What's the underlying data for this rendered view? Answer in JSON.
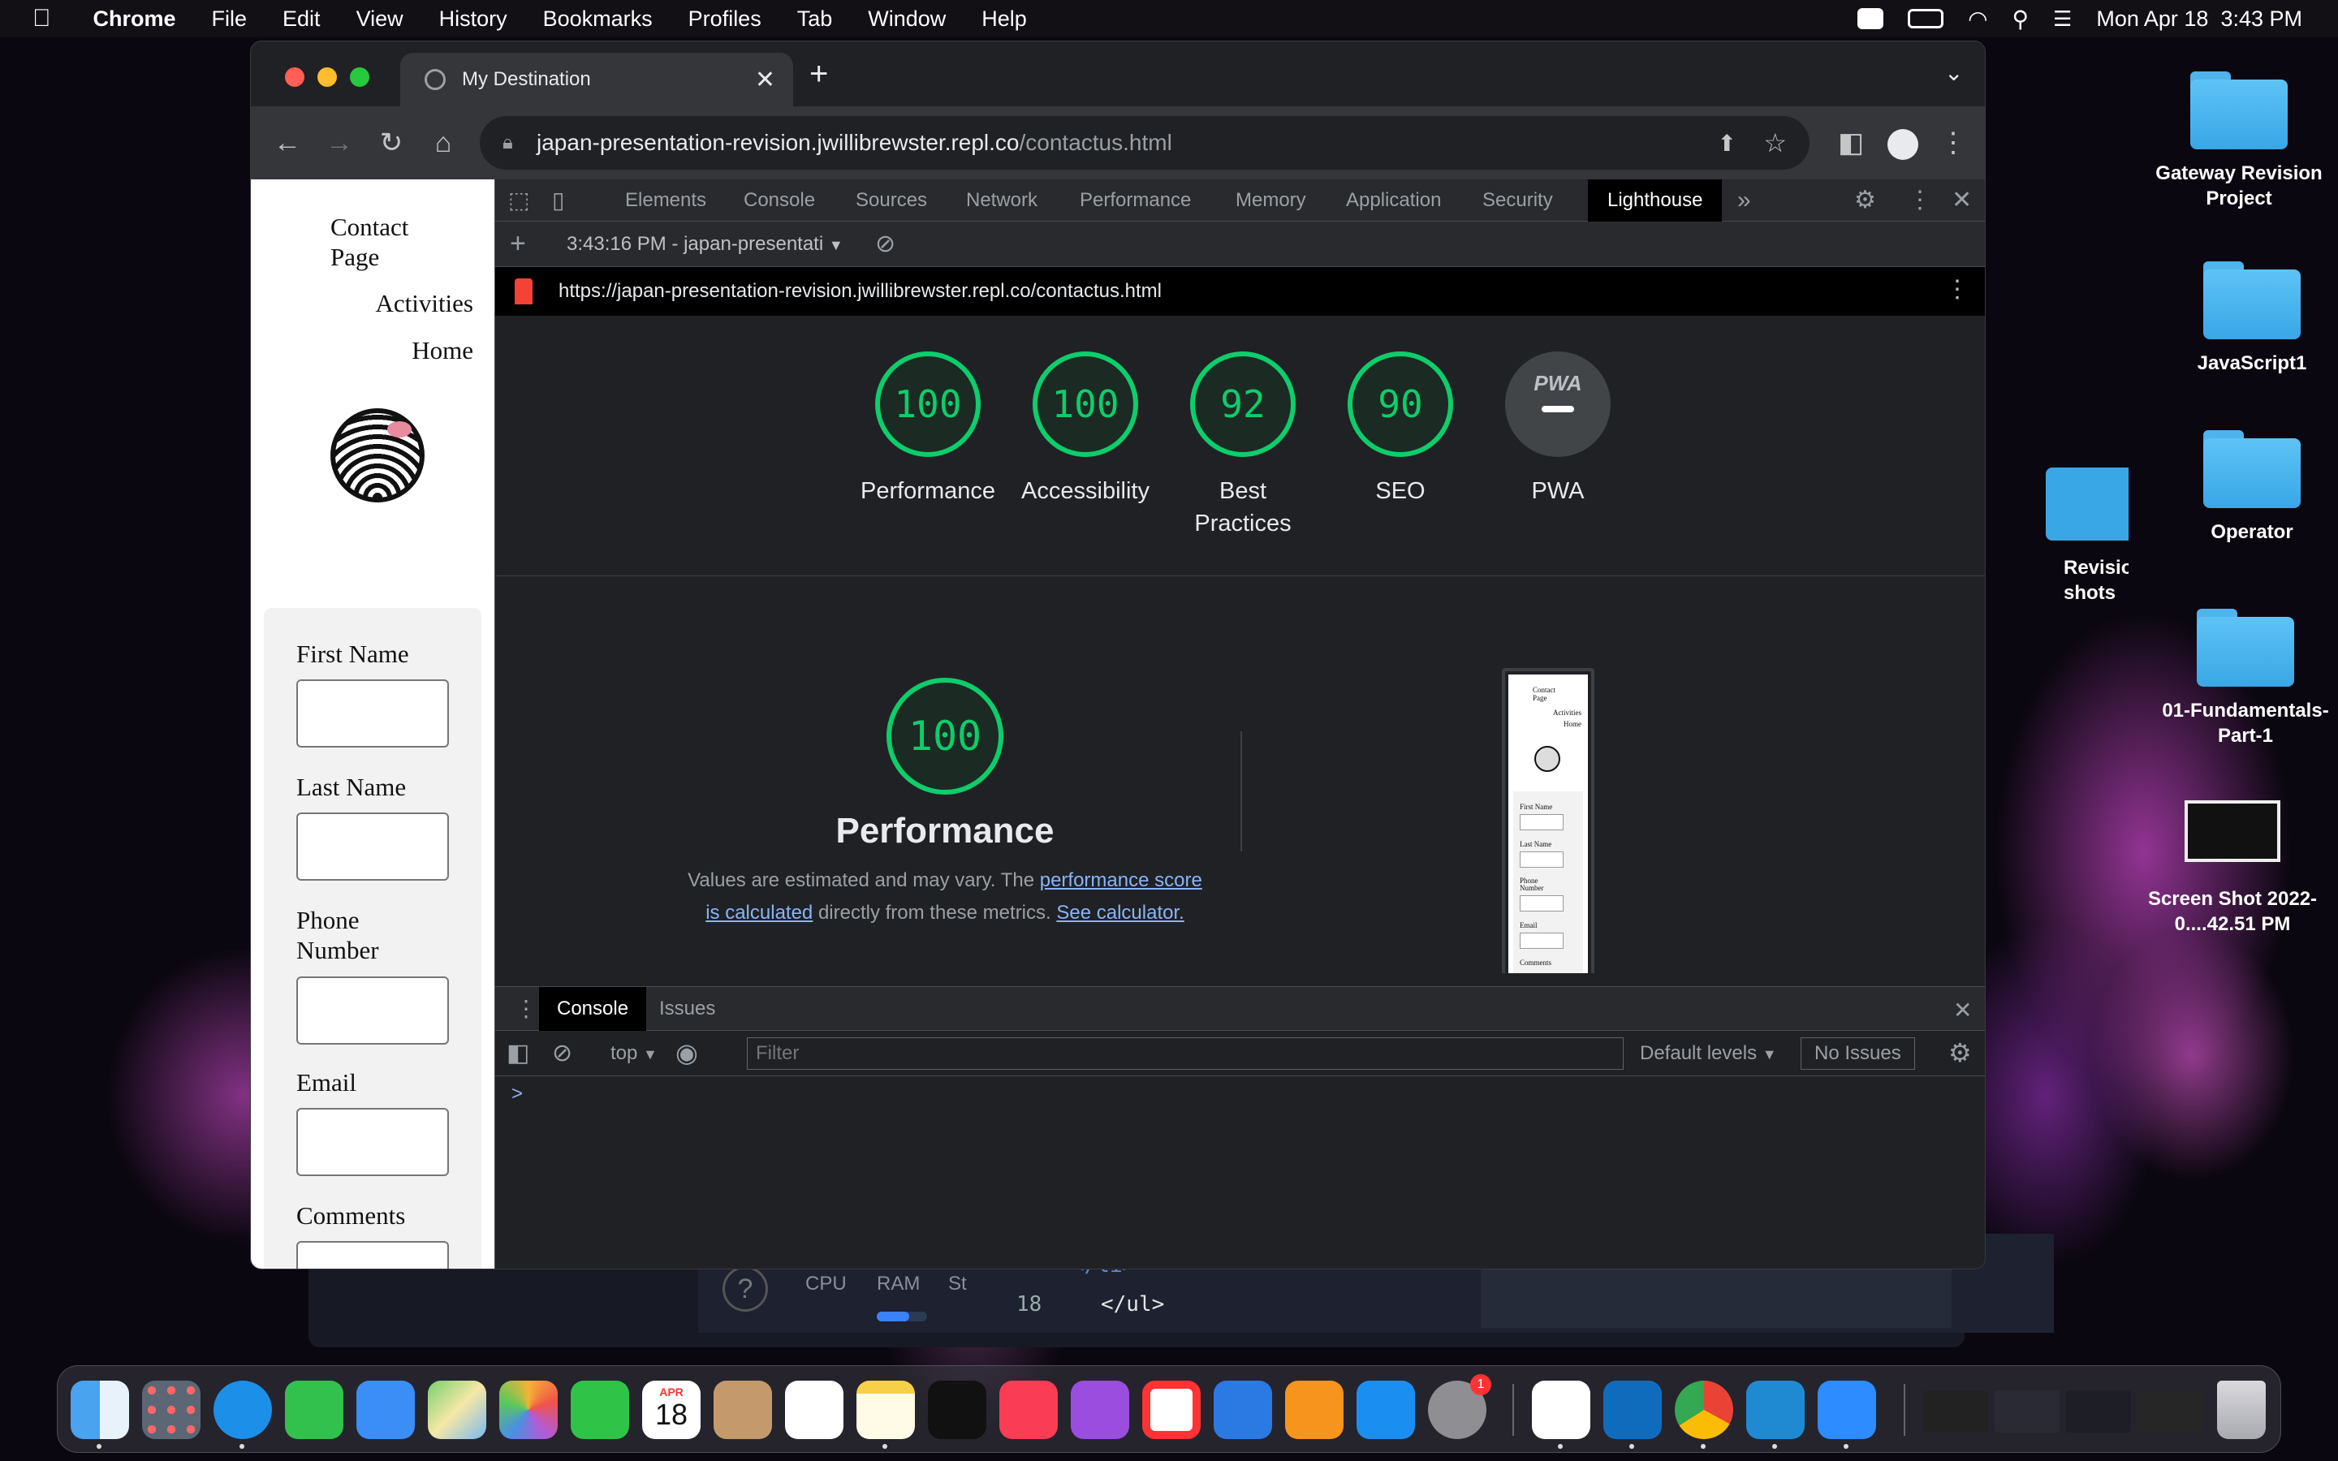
{
  "menubar": {
    "app": "Chrome",
    "items": [
      "File",
      "Edit",
      "View",
      "History",
      "Bookmarks",
      "Profiles",
      "Tab",
      "Window",
      "Help"
    ],
    "clock": "Mon Apr 18  3:43 PM"
  },
  "desktop": {
    "icons": [
      {
        "label": "Gateway Revision Project"
      },
      {
        "label": "JavaScript1"
      },
      {
        "label": "Operator"
      },
      {
        "label": "01-Fundamentals-Part-1"
      },
      {
        "label": "Screen Shot 2022-0....42.51 PM"
      },
      {
        "label": "Revision shots"
      }
    ]
  },
  "chrome": {
    "tab_title": "My Destination",
    "url_host": "japan-presentation-revision.jwillibrewster.repl.co",
    "url_path": "/contactus.html"
  },
  "page": {
    "nav": [
      "Contact Page",
      "Activities",
      "Home"
    ],
    "form_labels": [
      "First Name",
      "Last Name",
      "Phone Number",
      "Email",
      "Comments"
    ]
  },
  "devtools": {
    "tabs": [
      "Elements",
      "Console",
      "Sources",
      "Network",
      "Performance",
      "Memory",
      "Application",
      "Security",
      "Lighthouse"
    ],
    "active_tab": "Lighthouse",
    "report_selector": "3:43:16 PM - japan-presentati",
    "report_url": "https://japan-presentation-revision.jwillibrewster.repl.co/contactus.html",
    "scores": [
      {
        "label": "Performance",
        "value": 100
      },
      {
        "label": "Accessibility",
        "value": 100
      },
      {
        "label": "Best Practices",
        "value": 92
      },
      {
        "label": "SEO",
        "value": 90
      },
      {
        "label": "PWA",
        "value": null
      }
    ],
    "pwa_badge": "PWA",
    "perf_section": {
      "score": 100,
      "title": "Performance",
      "note_pre": "Values are estimated and may vary. The ",
      "link1": "performance score is calculated",
      "note_mid": " directly from these metrics. ",
      "link2": "See calculator."
    },
    "thumb": {
      "nav": [
        "Contact Page",
        "Activities",
        "Home"
      ],
      "fields": [
        "First Name",
        "Last Name",
        "Phone Number",
        "Email",
        "Comments"
      ]
    },
    "drawer": {
      "tabs": [
        "Console",
        "Issues"
      ],
      "context": "top",
      "filter_placeholder": "Filter",
      "levels": "Default levels",
      "issues": "No Issues",
      "prompt": ">"
    }
  },
  "bgwindow": {
    "labels": [
      "CPU",
      "RAM",
      "St"
    ],
    "line_no": "18",
    "code1": "</li>",
    "code2": "</ul>"
  },
  "dock": {
    "calendar_month": "APR",
    "calendar_day": "18",
    "settings_badge": "1"
  },
  "colors": {
    "score_green": "#0cce6b",
    "link_blue": "#8ab4f8",
    "lighthouse_active": "#000000"
  }
}
